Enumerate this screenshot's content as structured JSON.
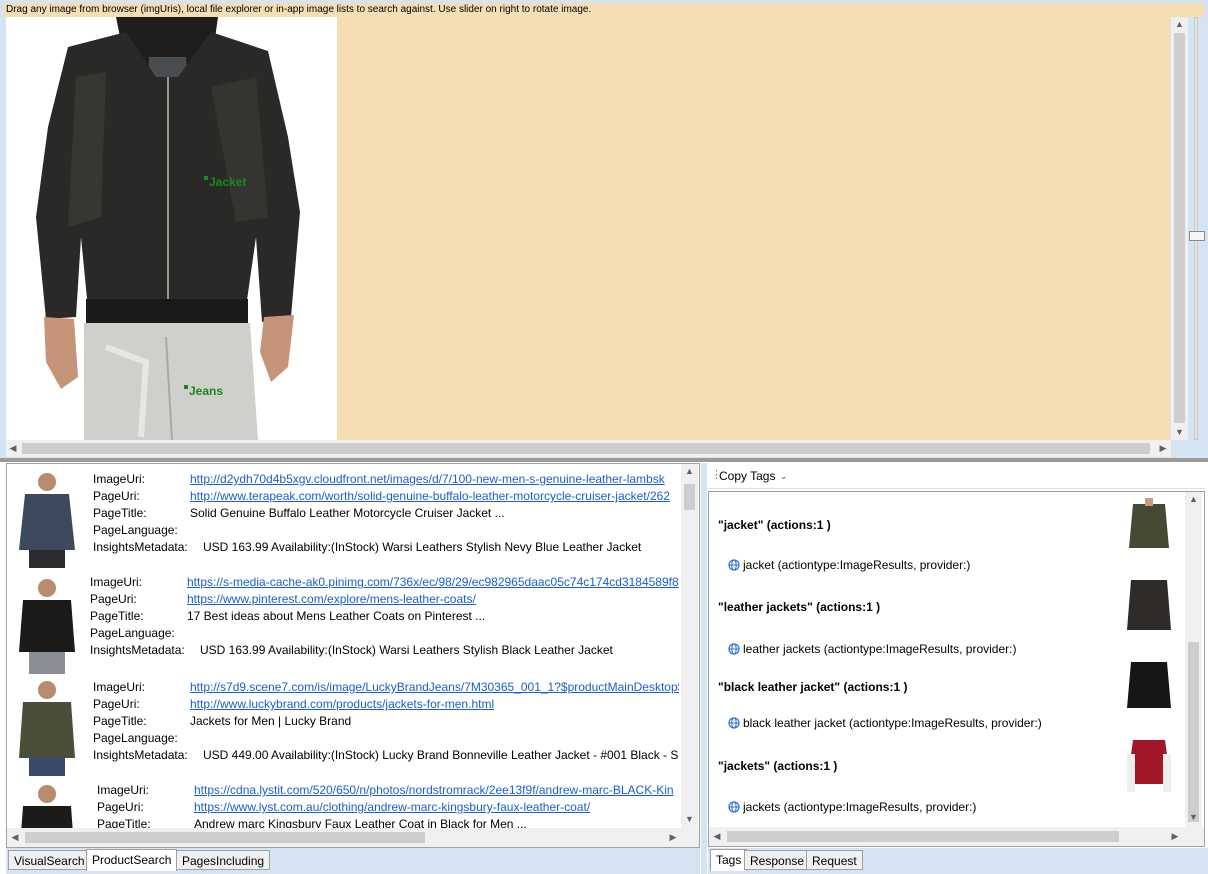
{
  "hint": "Drag any image from browser (imgUris), local file explorer or in-app image lists to search against. Use slider on right to rotate image.",
  "photo_tags": [
    {
      "label": "Jacket"
    },
    {
      "label": "Jeans"
    }
  ],
  "results": [
    {
      "image_uri_label": "ImageUri:",
      "image_uri": "http://d2ydh70d4b5xgv.cloudfront.net/images/d/7/100-new-men-s-genuine-leather-lambsk",
      "page_uri_label": "PageUri:",
      "page_uri": "http://www.terapeak.com/worth/solid-genuine-buffalo-leather-motorcycle-cruiser-jacket/262",
      "page_title_label": "PageTitle:",
      "page_title": "Solid Genuine Buffalo Leather Motorcycle Cruiser Jacket ...",
      "page_language_label": "PageLanguage:",
      "page_language": "",
      "insights_label": "InsightsMetadata:",
      "insights": "USD 163.99 Availability:(InStock) Warsi Leathers Stylish Nevy Blue Leather Jacket"
    },
    {
      "image_uri_label": "ImageUri:",
      "image_uri": "https://s-media-cache-ak0.pinimg.com/736x/ec/98/29/ec982965daac05c74c174cd3184589f8",
      "page_uri_label": "PageUri:",
      "page_uri": "https://www.pinterest.com/explore/mens-leather-coats/",
      "page_title_label": "PageTitle:",
      "page_title": "17 Best ideas about Mens Leather Coats on Pinterest ...",
      "page_language_label": "PageLanguage:",
      "page_language": "",
      "insights_label": "InsightsMetadata:",
      "insights": "USD 163.99 Availability:(InStock) Warsi Leathers Stylish Black Leather Jacket"
    },
    {
      "image_uri_label": "ImageUri:",
      "image_uri": "http://s7d9.scene7.com/is/image/LuckyBrandJeans/7M30365_001_1?$productMainDesktop$",
      "page_uri_label": "PageUri:",
      "page_uri": "http://www.luckybrand.com/products/jackets-for-men.html",
      "page_title_label": "PageTitle:",
      "page_title": "Jackets for Men | Lucky Brand",
      "page_language_label": "PageLanguage:",
      "page_language": "",
      "insights_label": "InsightsMetadata:",
      "insights": "USD 449.00 Availability:(InStock) Lucky Brand Bonneville Leather Jacket - #001 Black - S"
    },
    {
      "image_uri_label": "ImageUri:",
      "image_uri": "https://cdna.lystit.com/520/650/n/photos/nordstromrack/2ee13f9f/andrew-marc-BLACK-Kin",
      "page_uri_label": "PageUri:",
      "page_uri": "https://www.lyst.com.au/clothing/andrew-marc-kingsbury-faux-leather-coat/",
      "page_title_label": "PageTitle:",
      "page_title": "Andrew marc Kingsbury Faux Leather Coat in Black for Men ..."
    }
  ],
  "left_tabs": [
    "VisualSearch",
    "ProductSearch",
    "PagesIncluding"
  ],
  "toolbar": {
    "copy_tags": "Copy Tags"
  },
  "tags": [
    {
      "header": "\"jacket\" (actions:1 )",
      "item": "jacket (actiontype:ImageResults, provider:)"
    },
    {
      "header": "\"leather jackets\" (actions:1 )",
      "item": "leather jackets (actiontype:ImageResults, provider:)"
    },
    {
      "header": "\"black leather jacket\" (actions:1 )",
      "item": "black leather jacket (actiontype:ImageResults, provider:)"
    },
    {
      "header": "\"jackets\" (actions:1 )",
      "item": "jackets (actiontype:ImageResults, provider:)"
    }
  ],
  "right_tabs": [
    "Tags",
    "Response",
    "Request"
  ],
  "colors": {
    "canvas_bg": "#f5deb3",
    "tag_green": "#1a8a1a",
    "link_blue": "#1a5ed3",
    "chrome_blue": "#d5e4f2"
  }
}
